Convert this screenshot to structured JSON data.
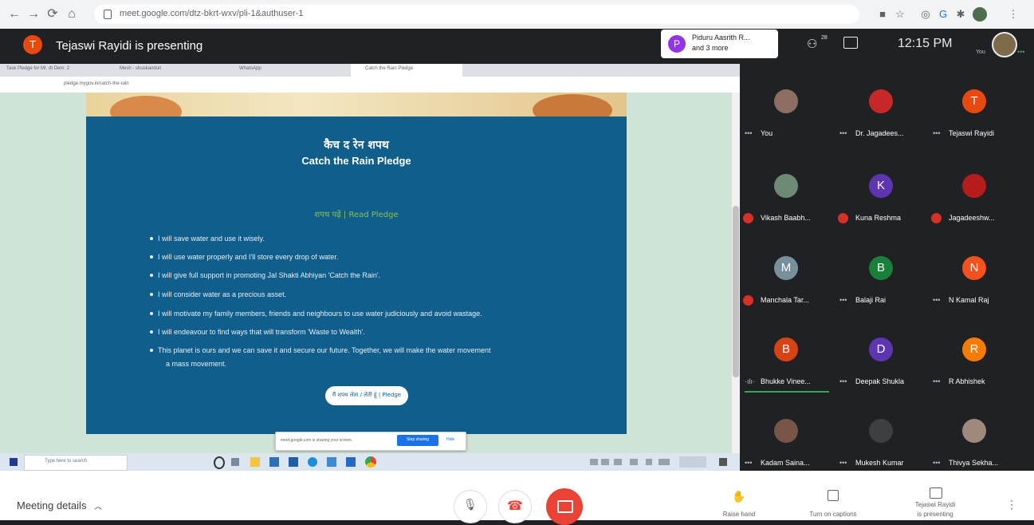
{
  "browser": {
    "url": "meet.google.com/dtz-bkrt-wxv/pli-1&authuser-1"
  },
  "meet_header": {
    "presenter_initial": "T",
    "presenter_text": "Tejaswi Rayidi is presenting",
    "participants_chip_initial": "P",
    "participants_chip_line1": "Piduru Aasrith R...",
    "participants_chip_line2": "and 3 more",
    "people_count": "28",
    "time": "12:15 PM",
    "self_label": "You",
    "accent_color": "#1a73e8"
  },
  "shared_screen": {
    "inner_tabs": [
      "Task Pledge for Mr. dt Dem: 2",
      "Mesh - shuskanduri",
      "WhatsApp",
      "Catch the Rain Pledge"
    ],
    "inner_url": "pledge.mygov.in/catch-the-rain",
    "pledge_title_hindi": "कैच द रेन शपथ",
    "pledge_title": "Catch the Rain Pledge",
    "read_pledge": "शपथ पढ़ें | Read Pledge",
    "pledge_items": [
      "I will save water and use it wisely.",
      "I will use water properly and I'll store every drop of water.",
      "I will give full support in promoting Jal Shakti Abhiyan 'Catch the Rain'.",
      "I will consider water as a precious asset.",
      "I will motivate my family members, friends and neighbours to use water judiciously and avoid wastage.",
      "I will endeavour to find ways that will transform 'Waste to Wealth'.",
      "This planet is ours and we can save it and secure our future. Together, we will make the water movement",
      "a mass movement."
    ],
    "pledge_button": "मैं शपथ लेता / लेती हूं | Pledge",
    "share_notice": "meet.google.com is sharing your screen.",
    "stop_sharing": "Stop sharing",
    "hide": "Hide",
    "taskbar_search": "Type here to search",
    "card_color": "#0f5e8c",
    "read_pledge_color": "#8bc34a"
  },
  "participants": [
    {
      "name": "You",
      "initial": "",
      "color": "#8d6e63",
      "mic": "dots"
    },
    {
      "name": "Dr. Jagadees...",
      "initial": "",
      "color": "#c62828",
      "mic": "dots"
    },
    {
      "name": "Tejaswi Rayidi",
      "initial": "T",
      "color": "#e8490f",
      "mic": "dots"
    },
    {
      "name": "Vikash Baabh...",
      "initial": "",
      "color": "#6d8b74",
      "mic": "muted"
    },
    {
      "name": "Kuna Reshma",
      "initial": "K",
      "color": "#5e35b1",
      "mic": "muted"
    },
    {
      "name": "Jagadeeshw...",
      "initial": "",
      "color": "#b71c1c",
      "mic": "muted"
    },
    {
      "name": "Manchala Tar...",
      "initial": "M",
      "color": "#78909c",
      "mic": "muted"
    },
    {
      "name": "Balaji Rai",
      "initial": "B",
      "color": "#188038",
      "mic": "dots"
    },
    {
      "name": "N Kamal Raj",
      "initial": "N",
      "color": "#f4511e",
      "mic": "dots"
    },
    {
      "name": "Bhukke Vinee...",
      "initial": "B",
      "color": "#d84315",
      "mic": "speaking"
    },
    {
      "name": "Deepak Shukla",
      "initial": "D",
      "color": "#5e35b1",
      "mic": "dots"
    },
    {
      "name": "R Abhishek",
      "initial": "R",
      "color": "#f57c00",
      "mic": "dots"
    },
    {
      "name": "Kadam Saina...",
      "initial": "",
      "color": "#795548",
      "mic": "dots"
    },
    {
      "name": "Mukesh Kumar",
      "initial": "",
      "color": "#3c4043",
      "mic": "dots"
    },
    {
      "name": "Thivya Sekha...",
      "initial": "",
      "color": "#a1887f",
      "mic": "dots"
    }
  ],
  "bottom_bar": {
    "meeting_details": "Meeting details",
    "raise_hand": "Raise hand",
    "captions": "Turn on captions",
    "presenting_line1": "Tejaswi Rayidi",
    "presenting_line2": "is presenting",
    "end_call_color": "#ea4335"
  }
}
